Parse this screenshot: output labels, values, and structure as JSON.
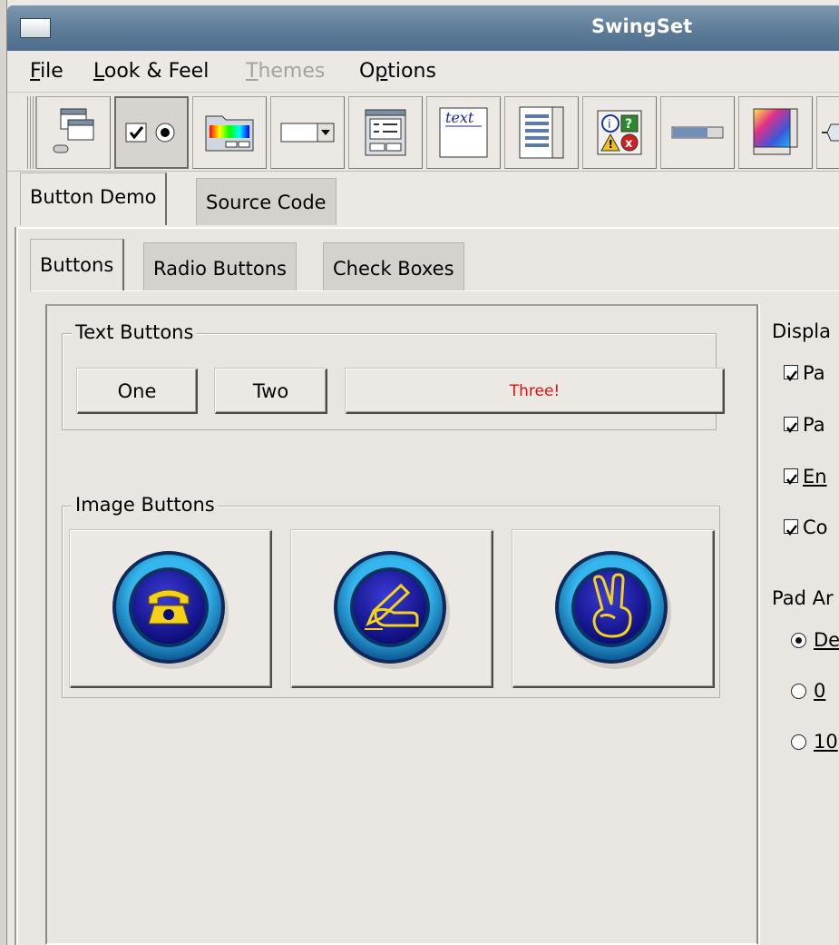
{
  "window": {
    "title": "SwingSet"
  },
  "menu": [
    {
      "label": "File",
      "mnemonic": "F",
      "rest": "ile",
      "enabled": true
    },
    {
      "label": "Look & Feel",
      "mnemonic": "L",
      "rest": "ook & Feel",
      "enabled": true
    },
    {
      "label": "Themes",
      "mnemonic": "T",
      "rest": "hemes",
      "enabled": false
    },
    {
      "label": "Options",
      "mnemonic": "p",
      "pre": "O",
      "rest": "tions",
      "enabled": true
    }
  ],
  "toolbar": {
    "buttons": [
      "internal-frame-demo-icon",
      "button-demo-icon",
      "color-chooser-demo-icon",
      "combobox-demo-icon",
      "file-chooser-demo-icon",
      "editor-pane-demo-icon",
      "list-demo-icon",
      "option-pane-demo-icon",
      "progress-bar-demo-icon",
      "scroll-pane-demo-icon",
      "slider-demo-icon"
    ],
    "selected_index": 1,
    "editor_icon_text": "text"
  },
  "outer_tabs": {
    "demo": "Button Demo",
    "source": "Source Code"
  },
  "inner_tabs": {
    "buttons": "Buttons",
    "radio": "Radio Buttons",
    "check": "Check Boxes"
  },
  "text_buttons": {
    "group_title": "Text Buttons",
    "one": "One",
    "two": "Two",
    "three": "Three!"
  },
  "image_buttons": {
    "group_title": "Image Buttons",
    "icons": [
      "phone-icon",
      "write-icon",
      "peace-hand-icon"
    ]
  },
  "display_options": {
    "title": "Displa",
    "checkboxes": [
      {
        "label": "Pa",
        "checked": true
      },
      {
        "label": "Pa",
        "checked": true
      },
      {
        "label": "En",
        "checked": true
      },
      {
        "label": "Co",
        "checked": true
      }
    ]
  },
  "pad_amount": {
    "title": "Pad Ar",
    "options": [
      {
        "label": "De",
        "selected": true
      },
      {
        "label": "0",
        "selected": false
      },
      {
        "label": "10",
        "selected": false
      }
    ]
  },
  "colors": {
    "titlebar": "#5a7a96",
    "icon_blue": "#1e3fa8",
    "icon_ring": "#2a9ed8",
    "icon_yellow": "#f4d21a",
    "three_text": "#e01010"
  }
}
